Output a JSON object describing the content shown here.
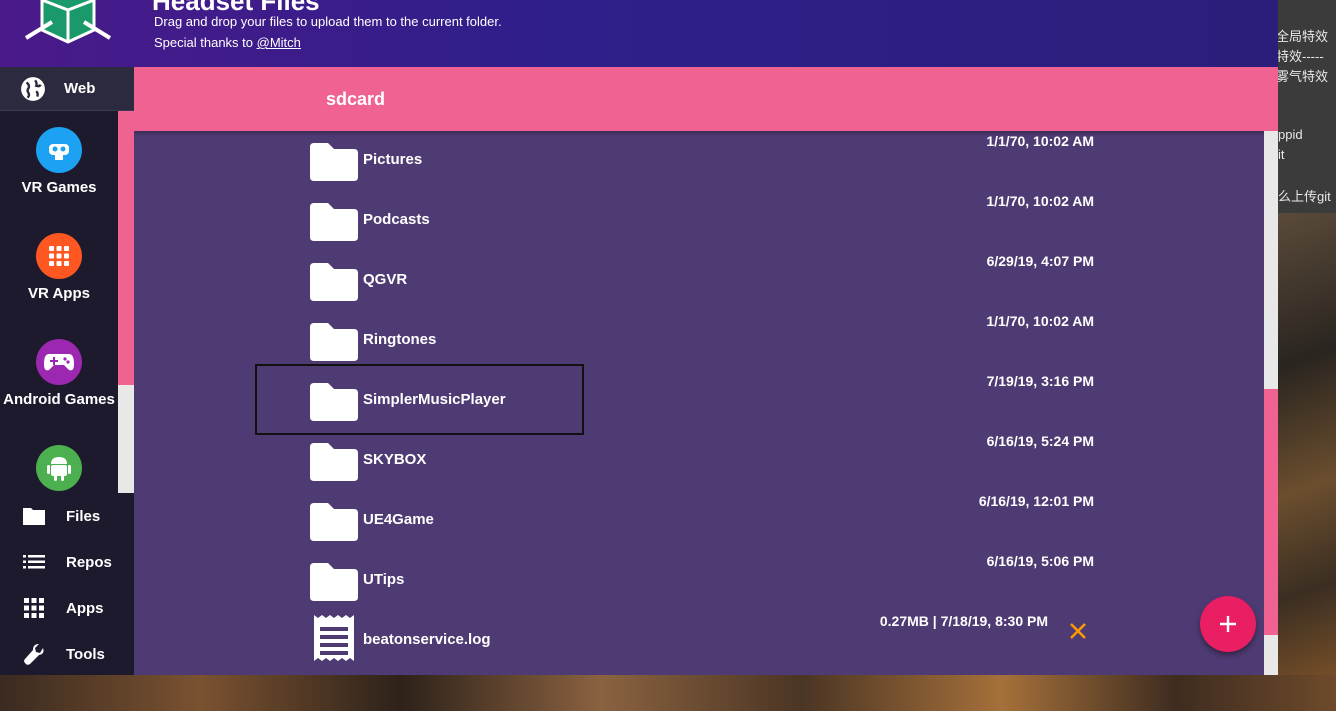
{
  "header": {
    "title": "Headset Files",
    "description": "Drag and drop your files to upload them to the current folder.",
    "thanks_prefix": "Special thanks to ",
    "thanks_link": "@Mitch"
  },
  "sidebar": {
    "web_label": "Web",
    "tiles": [
      {
        "label": "VR Games",
        "icon": "vr-headset-icon",
        "color": "#1da1f2"
      },
      {
        "label": "VR Apps",
        "icon": "grid-icon",
        "color": "#ff5722"
      },
      {
        "label": "Android Games",
        "icon": "gamepad-icon",
        "color": "#9c27b0"
      },
      {
        "label": "",
        "icon": "android-icon",
        "color": "#4caf50"
      }
    ],
    "nav": [
      {
        "label": "Files",
        "icon": "folder-icon"
      },
      {
        "label": "Repos",
        "icon": "list-icon"
      },
      {
        "label": "Apps",
        "icon": "apps-grid-icon"
      },
      {
        "label": "Tools",
        "icon": "wrench-icon"
      }
    ]
  },
  "main": {
    "path": "sdcard",
    "files": [
      {
        "name": "Pictures",
        "date": "1/1/70, 10:02 AM",
        "type": "folder"
      },
      {
        "name": "Podcasts",
        "date": "1/1/70, 10:02 AM",
        "type": "folder"
      },
      {
        "name": "QGVR",
        "date": "6/29/19, 4:07 PM",
        "type": "folder"
      },
      {
        "name": "Ringtones",
        "date": "1/1/70, 10:02 AM",
        "type": "folder"
      },
      {
        "name": "SimplerMusicPlayer",
        "date": "7/19/19, 3:16 PM",
        "type": "folder"
      },
      {
        "name": "SKYBOX",
        "date": "6/16/19, 5:24 PM",
        "type": "folder"
      },
      {
        "name": "UE4Game",
        "date": "6/16/19, 12:01 PM",
        "type": "folder"
      },
      {
        "name": "UTips",
        "date": "6/16/19, 5:06 PM",
        "type": "folder"
      },
      {
        "name": "beatonservice.log",
        "meta": "0.27MB | 7/18/19, 8:30 PM",
        "type": "file"
      }
    ]
  },
  "background": {
    "cn_lines": [
      "全局特效",
      "特效-----",
      "雾气特效",
      "ppid",
      "it",
      "么上传git"
    ]
  },
  "colors": {
    "header": "#2e1f8a",
    "panel": "#4f3b73",
    "accent_pink": "#f06292",
    "fab": "#e91e63",
    "delete_orange": "#ff9800"
  }
}
